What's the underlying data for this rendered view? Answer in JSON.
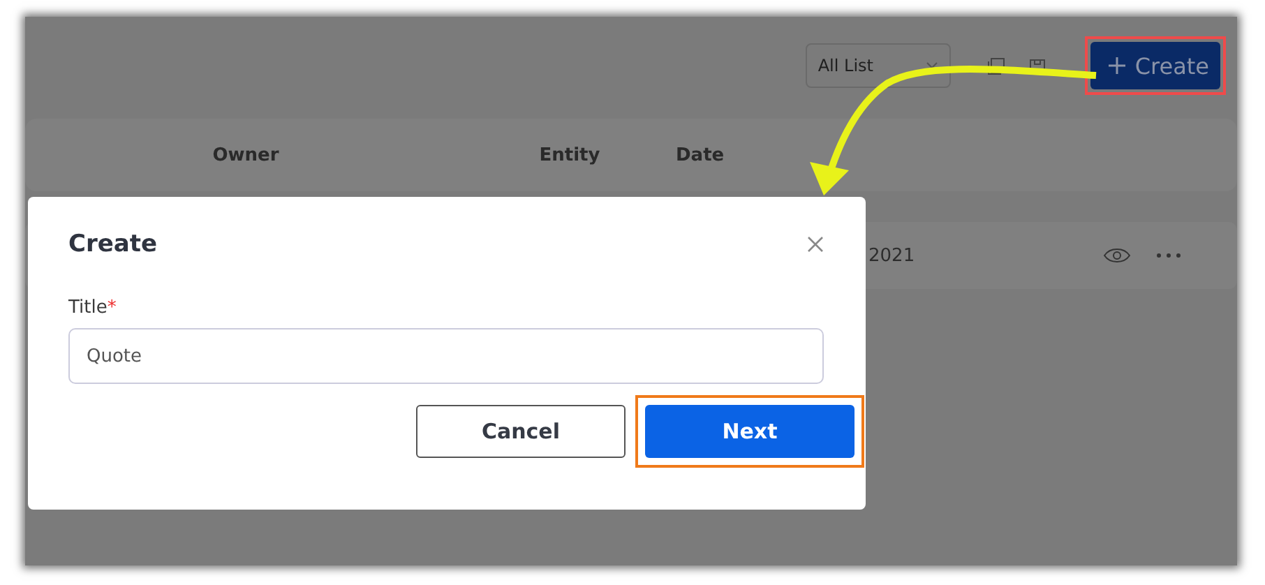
{
  "toolbar": {
    "list_filter": "All List",
    "create_button": {
      "label": "Create",
      "highlighted": true
    }
  },
  "table": {
    "columns": [
      "Owner",
      "Entity",
      "Date"
    ],
    "rows": [
      {
        "date": "2021"
      }
    ]
  },
  "dialog": {
    "title": "Create",
    "field": {
      "label": "Title",
      "required_mark": "*",
      "value": "Quote"
    },
    "buttons": [
      {
        "label": "Cancel",
        "kind": "secondary",
        "highlighted": false
      },
      {
        "label": "Next",
        "kind": "primary",
        "highlighted": true
      }
    ]
  }
}
